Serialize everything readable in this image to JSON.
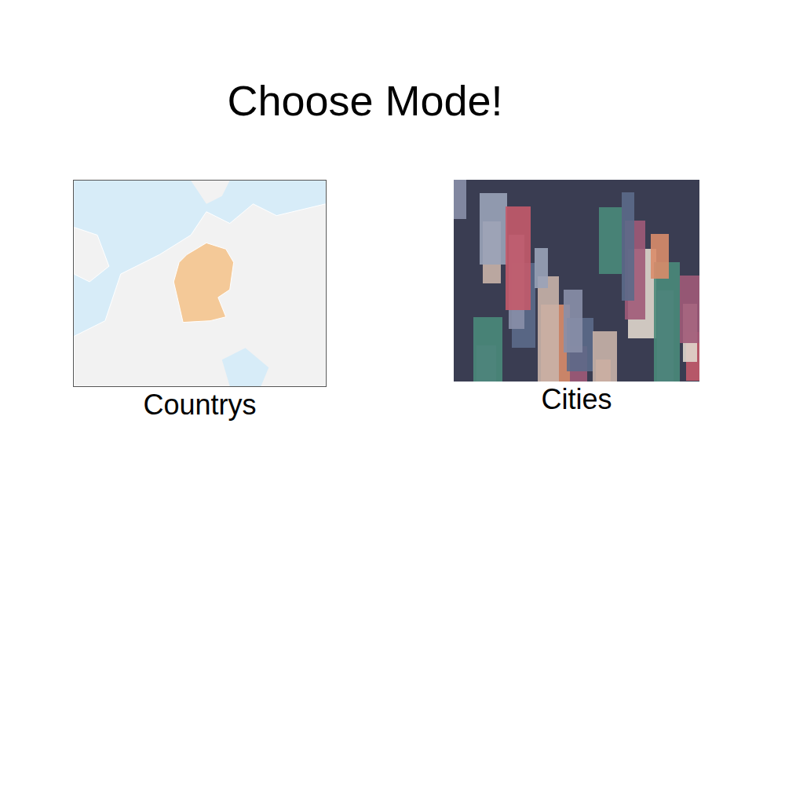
{
  "title": "Choose Mode!",
  "modes": [
    {
      "label": "Countrys",
      "kind": "map"
    },
    {
      "label": "Cities",
      "kind": "city"
    }
  ]
}
